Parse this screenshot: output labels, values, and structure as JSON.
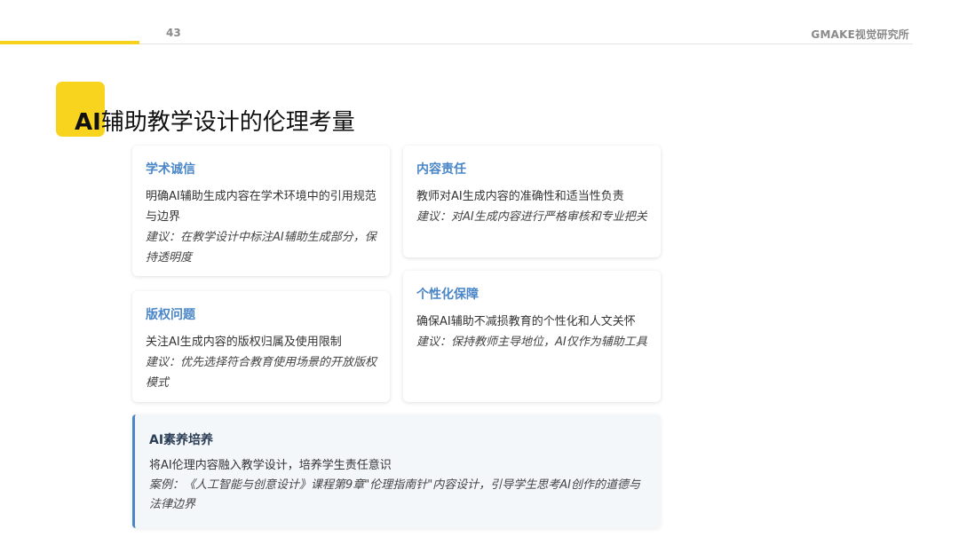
{
  "header": {
    "page_number": "43",
    "brand": "GMAKE视觉研究所"
  },
  "slide": {
    "title_ai": "AI",
    "title_rest": "辅助教学设计的伦理考量"
  },
  "cards": {
    "academic": {
      "title": "学术诚信",
      "body": "明确AI辅助生成内容在学术环境中的引用规范与边界",
      "suggestion": "建议：在教学设计中标注AI辅助生成部分，保持透明度"
    },
    "copyright": {
      "title": "版权问题",
      "body": "关注AI生成内容的版权归属及使用限制",
      "suggestion": "建议：优先选择符合教育使用场景的开放版权模式"
    },
    "content": {
      "title": "内容责任",
      "body": "教师对AI生成内容的准确性和适当性负责",
      "suggestion": "建议：对AI生成内容进行严格审核和专业把关"
    },
    "personal": {
      "title": "个性化保障",
      "body": "确保AI辅助不减损教育的个性化和人文关怀",
      "suggestion": "建议：保持教师主导地位，AI仅作为辅助工具"
    },
    "literacy": {
      "title": "AI素养培养",
      "body": "将AI伦理内容融入教学设计，培养学生责任意识",
      "case": "案例：《人工智能与创意设计》课程第9章\"伦理指南针\"内容设计，引导学生思考AI创作的道德与法律边界"
    }
  },
  "colors": {
    "accent_yellow": "#f5d31c",
    "card_title_blue": "#4a86c8",
    "highlight_bg": "#f4f7fa"
  }
}
